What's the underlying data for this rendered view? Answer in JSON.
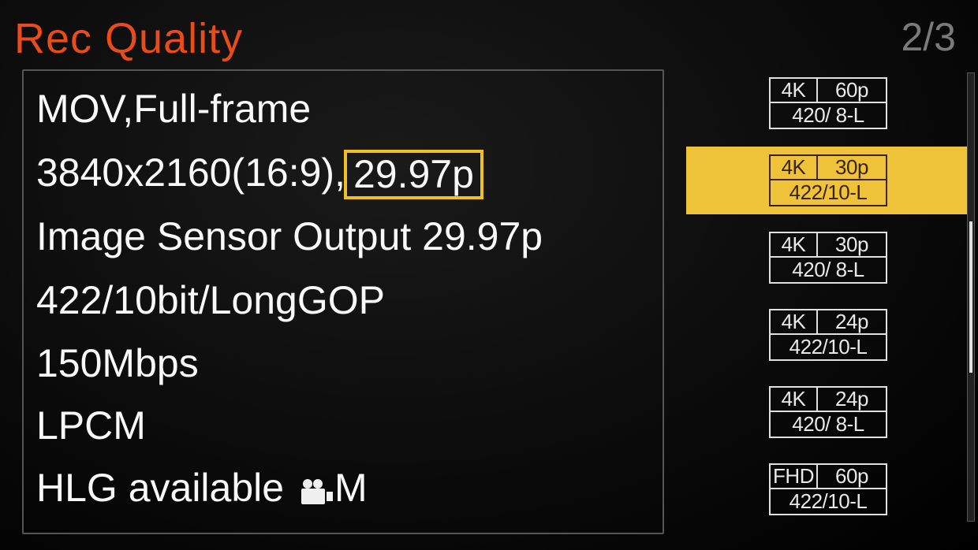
{
  "header": {
    "title": "Rec Quality",
    "page_indicator": "2/3"
  },
  "detail": {
    "line1": "MOV,Full-frame",
    "line2_a": "3840x2160(16:9),",
    "line2_highlight": "29.97p",
    "line3": "Image Sensor Output 29.97p",
    "line4": "422/10bit/LongGOP",
    "line5": "150Mbps",
    "line6": "LPCM",
    "line7": "HLG available",
    "line7_suffix": "M"
  },
  "options": [
    {
      "res": "4K",
      "fps": "60p",
      "codec": "420/ 8-L",
      "selected": false
    },
    {
      "res": "4K",
      "fps": "30p",
      "codec": "422/10-L",
      "selected": true
    },
    {
      "res": "4K",
      "fps": "30p",
      "codec": "420/ 8-L",
      "selected": false
    },
    {
      "res": "4K",
      "fps": "24p",
      "codec": "422/10-L",
      "selected": false
    },
    {
      "res": "4K",
      "fps": "24p",
      "codec": "420/ 8-L",
      "selected": false
    },
    {
      "res": "FHD",
      "fps": "60p",
      "codec": "422/10-L",
      "selected": false
    }
  ]
}
